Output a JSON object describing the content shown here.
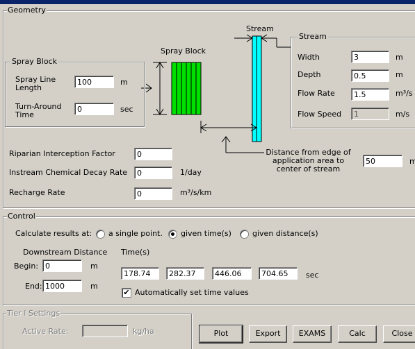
{
  "geometry": {
    "label": "Geometry",
    "diagram": {
      "stream_label": "Stream",
      "spray_block_label": "Spray Block"
    },
    "spray_block": {
      "label": "Spray Block",
      "spray_line_length_label": "Spray Line Length",
      "spray_line_length_value": "100",
      "spray_line_length_unit": "m",
      "turn_around_label": "Turn-Around Time",
      "turn_around_value": "0",
      "turn_around_unit": "sec"
    },
    "stream": {
      "label": "Stream",
      "width_label": "Width",
      "width_value": "3",
      "width_unit": "m",
      "depth_label": "Depth",
      "depth_value": "0.5",
      "depth_unit": "m",
      "flow_rate_label": "Flow Rate",
      "flow_rate_value": "1.5",
      "flow_rate_unit": "m³/s",
      "flow_speed_label": "Flow Speed",
      "flow_speed_value": "1",
      "flow_speed_unit": "m/s"
    },
    "distance": {
      "label": "Distance from edge of application area to center of stream",
      "value": "50",
      "unit": "m"
    },
    "riparian": {
      "label": "Riparian Interception Factor",
      "value": "0"
    },
    "decay": {
      "label": "Instream Chemical Decay Rate",
      "value": "0",
      "unit": "1/day"
    },
    "recharge": {
      "label": "Recharge Rate",
      "value": "0",
      "unit": "m³/s/km"
    }
  },
  "control": {
    "label": "Control",
    "calc_label": "Calculate results at:",
    "options": [
      "a single point.",
      "given time(s)",
      "given distance(s)"
    ],
    "selected_option": "given time(s)",
    "downstream_label": "Downstream Distance",
    "begin_label": "Begin:",
    "begin_value": "0",
    "begin_unit": "m",
    "end_label": "End:",
    "end_value": "1000",
    "end_unit": "m",
    "times_label": "Time(s)",
    "times": [
      "178.74",
      "282.37",
      "446.06",
      "704.65"
    ],
    "times_unit": "sec",
    "auto_time_label": "Automatically set time values",
    "auto_time_checked": true
  },
  "tier": {
    "label": "Tier I Settings",
    "active_rate_label": "Active Rate:",
    "active_rate_value": "",
    "active_rate_unit": "kg/ha"
  },
  "buttons": {
    "plot": "Plot",
    "export": "Export",
    "exams": "EXAMS",
    "calc": "Calc",
    "close": "Close"
  },
  "colors": {
    "stream": "#00ffff",
    "spray_rows": "#00e000",
    "window": "#d4d0c8",
    "titlebar": "#0a246a"
  }
}
